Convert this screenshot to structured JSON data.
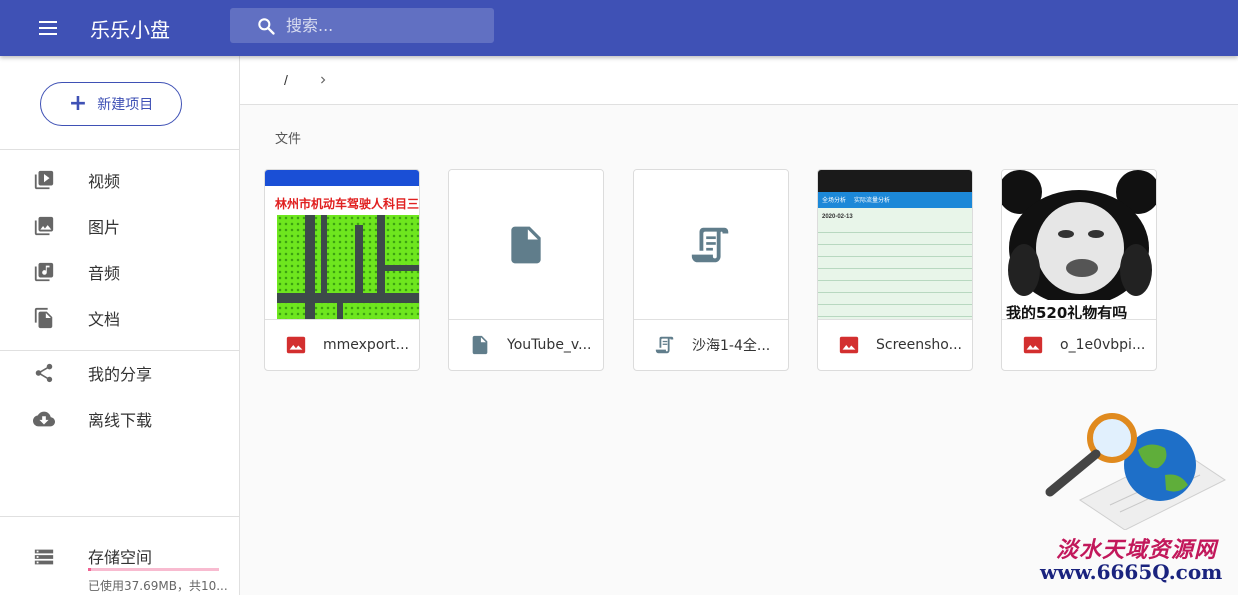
{
  "header": {
    "title": "乐乐小盘",
    "search_placeholder": "搜索..."
  },
  "sidebar": {
    "new_button": "新建项目",
    "items": [
      {
        "label": "视频",
        "icon": "video-library-icon"
      },
      {
        "label": "图片",
        "icon": "photo-library-icon"
      },
      {
        "label": "音频",
        "icon": "music-library-icon"
      },
      {
        "label": "文档",
        "icon": "documents-icon"
      },
      {
        "label": "我的分享",
        "icon": "share-icon"
      },
      {
        "label": "离线下载",
        "icon": "cloud-download-icon"
      }
    ],
    "storage": {
      "title": "存储空间",
      "usage_text": "已使用37.69MB，共10...",
      "used_fraction": 0.02
    }
  },
  "breadcrumb": {
    "root": "/"
  },
  "main": {
    "section_label": "文件",
    "files": [
      {
        "name": "mmexport...",
        "type_icon": "image-file-icon",
        "thumb_title": "林州市机动车驾驶人科目三"
      },
      {
        "name": "YouTube_v...",
        "type_icon": "document-file-icon"
      },
      {
        "name": "沙海1-4全...",
        "type_icon": "scroll-file-icon"
      },
      {
        "name": "Screensho...",
        "type_icon": "image-file-icon",
        "thumb_tabs": [
          "全场分析",
          "实际流量分析"
        ],
        "thumb_date": "2020-02-13"
      },
      {
        "name": "o_1e0vbpi...",
        "type_icon": "image-file-icon",
        "thumb_caption": "我的520礼物有吗"
      }
    ]
  },
  "watermark": {
    "line1": "淡水天域资源网",
    "line2": "www.6665Q.com"
  },
  "colors": {
    "primary": "#3f51b5",
    "accent_pink": "#f06292",
    "image_red": "#d32f2f",
    "file_gray": "#607d8b"
  }
}
